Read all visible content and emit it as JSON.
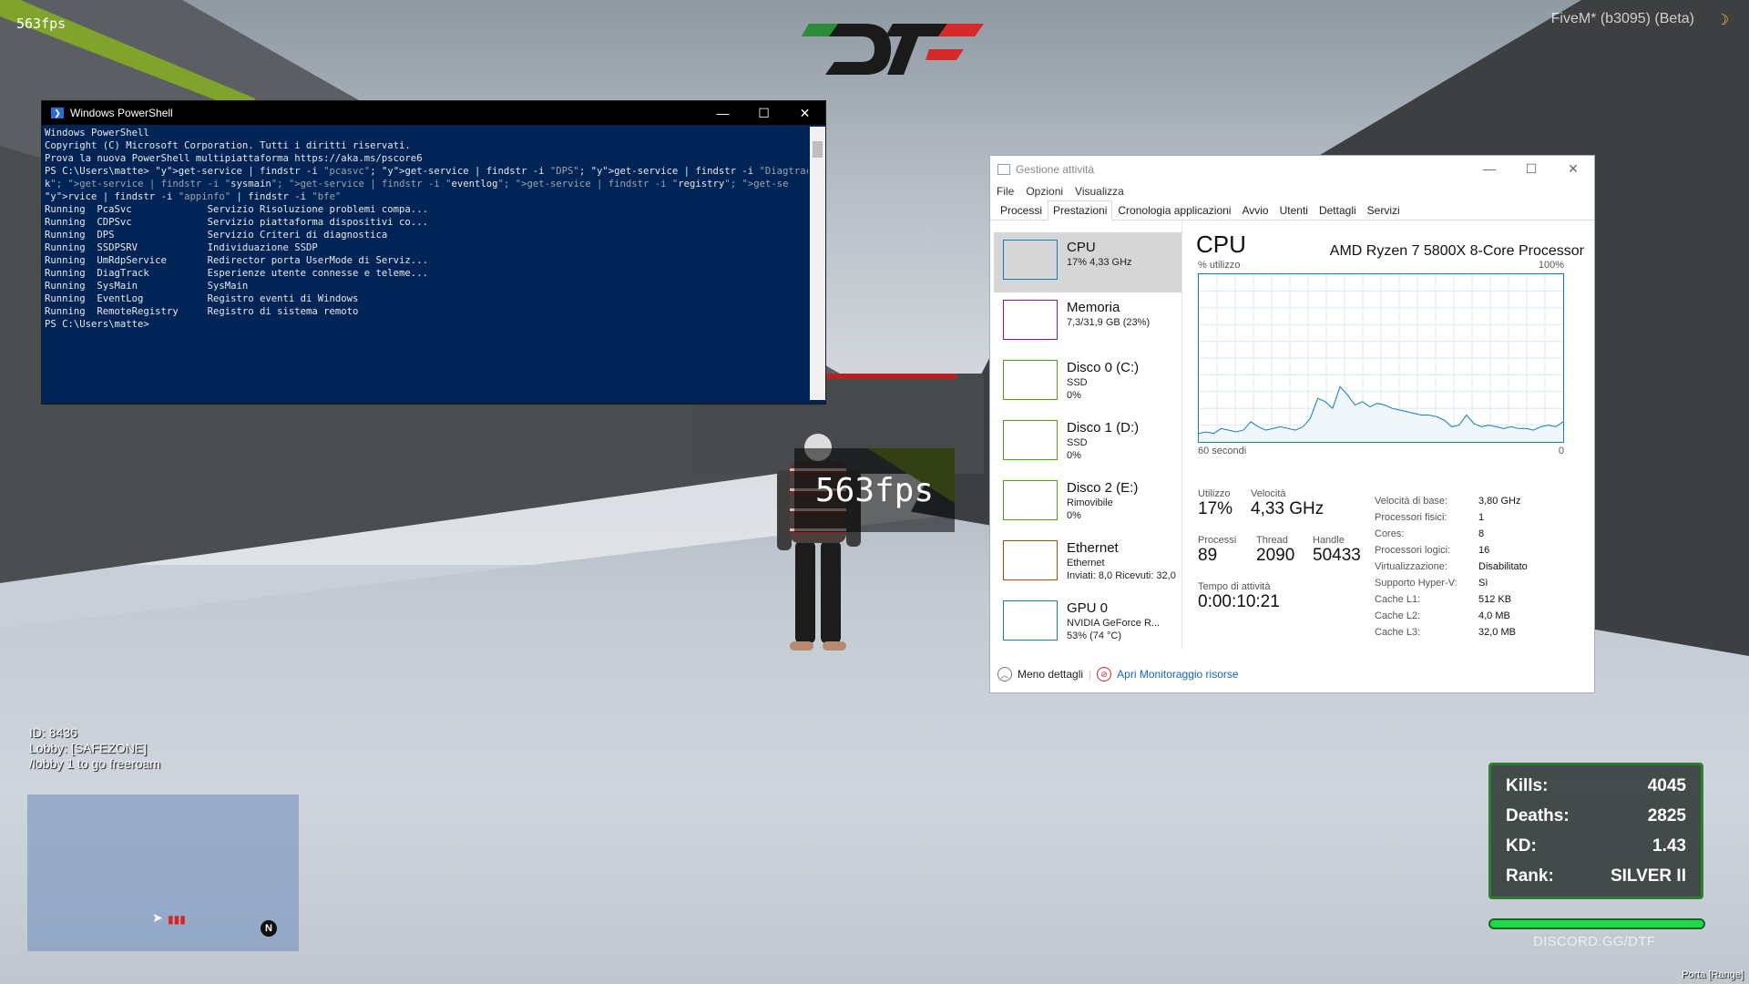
{
  "hud": {
    "fps_top": "563fps",
    "fps_overlay": "563fps",
    "fivem_label": "FiveM* (b3095) (Beta)",
    "lobby_lines": [
      "ID: 8436",
      "Lobby: [SAFEZONE]",
      "/lobby 1 to go freeroam"
    ],
    "stats": [
      {
        "label": "Kills:",
        "value": "4045"
      },
      {
        "label": "Deaths:",
        "value": "2825"
      },
      {
        "label": "KD:",
        "value": "1.43"
      },
      {
        "label": "Rank:",
        "value": "SILVER II"
      }
    ],
    "discord": "DISCORD.GG/DTF",
    "corner": "Porta [Range]",
    "minimap_north": "N",
    "health_fraction": 1.0
  },
  "powershell": {
    "title": "Windows PowerShell",
    "lines": [
      "Windows PowerShell",
      "Copyright (C) Microsoft Corporation. Tutti i diritti riservati.",
      "",
      "Prova la nuova PowerShell multipiattaforma https://aka.ms/pscore6",
      "",
      "PS C:\\Users\\matte> get-service | findstr -i \"pcasvc\"; get-service | findstr -i \"DPS\"; get-service | findstr -i \"Diagtrac",
      "k\"; get-service | findstr -i \"sysmain\"; get-service | findstr -i \"eventlog\"; get-service | findstr -i \"registry\"; get-se",
      "rvice | findstr -i \"appinfo\" | findstr -i \"bfe\"",
      "Running  PcaSvc             Servizio Risoluzione problemi compa...",
      "Running  CDPSvc             Servizio piattaforma dispositivi co...",
      "Running  DPS                Servizio Criteri di diagnostica",
      "Running  SSDPSRV            Individuazione SSDP",
      "Running  UmRdpService       Redirector porta UserMode di Serviz...",
      "Running  DiagTrack          Esperienze utente connesse e teleme...",
      "Running  SysMain            SysMain",
      "Running  EventLog           Registro eventi di Windows",
      "Running  RemoteRegistry     Registro di sistema remoto",
      "PS C:\\Users\\matte>"
    ]
  },
  "taskmgr": {
    "title": "Gestione attività",
    "menu": [
      "File",
      "Opzioni",
      "Visualizza"
    ],
    "tabs": [
      "Processi",
      "Prestazioni",
      "Cronologia applicazioni",
      "Avvio",
      "Utenti",
      "Dettagli",
      "Servizi"
    ],
    "active_tab": "Prestazioni",
    "resources": [
      {
        "name": "CPU",
        "l1": "17% 4,33 GHz",
        "l2": "",
        "l3": "",
        "color": "#117dbb"
      },
      {
        "name": "Memoria",
        "l1": "7,3/31,9 GB (23%)",
        "l2": "",
        "l3": "",
        "color": "#8b12ae"
      },
      {
        "name": "Disco 0 (C:)",
        "l1": "SSD",
        "l2": "0%",
        "l3": "",
        "color": "#4da60c"
      },
      {
        "name": "Disco 1 (D:)",
        "l1": "SSD",
        "l2": "0%",
        "l3": "",
        "color": "#4da60c"
      },
      {
        "name": "Disco 2 (E:)",
        "l1": "Rimovibile",
        "l2": "0%",
        "l3": "",
        "color": "#4da60c"
      },
      {
        "name": "Ethernet",
        "l1": "Ethernet",
        "l2": "Inviati: 8,0 Ricevuti: 32,0",
        "l3": "",
        "color": "#a74f01"
      },
      {
        "name": "GPU 0",
        "l1": "NVIDIA GeForce R...",
        "l2": "53% (74 °C)",
        "l3": "",
        "color": "#117dbb"
      }
    ],
    "cpu": {
      "heading": "CPU",
      "model": "AMD Ryzen 7 5800X 8-Core Processor",
      "usage_label": "% utilizzo",
      "max_label": "100%",
      "time_label": "60 secondi",
      "min_label": "0",
      "utilizzo_k": "Utilizzo",
      "utilizzo_v": "17%",
      "velocita_k": "Velocità",
      "velocita_v": "4,33 GHz",
      "processi_k": "Processi",
      "processi_v": "89",
      "thread_k": "Thread",
      "thread_v": "2090",
      "handle_k": "Handle",
      "handle_v": "50433",
      "uptime_k": "Tempo di attività",
      "uptime_v": "0:00:10:21",
      "props": [
        {
          "k": "Velocità di base:",
          "v": "3,80 GHz"
        },
        {
          "k": "Processori fisici:",
          "v": "1"
        },
        {
          "k": "Cores:",
          "v": "8"
        },
        {
          "k": "Processori logici:",
          "v": "16"
        },
        {
          "k": "Virtualizzazione:",
          "v": "Disabilitato"
        },
        {
          "k": "Supporto Hyper-V:",
          "v": "Sì"
        },
        {
          "k": "Cache L1:",
          "v": "512 KB"
        },
        {
          "k": "Cache L2:",
          "v": "4,0 MB"
        },
        {
          "k": "Cache L3:",
          "v": "32,0 MB"
        }
      ],
      "history": [
        5,
        6,
        5,
        8,
        7,
        6,
        7,
        12,
        9,
        7,
        8,
        9,
        8,
        7,
        9,
        14,
        26,
        24,
        20,
        33,
        28,
        22,
        24,
        21,
        23,
        22,
        20,
        19,
        18,
        17,
        16,
        16,
        15,
        13,
        9,
        10,
        16,
        11,
        9,
        10,
        9,
        8,
        9,
        8,
        8,
        7,
        9,
        10,
        9,
        12
      ]
    },
    "footer_less": "Meno dettagli",
    "footer_link": "Apri Monitoraggio risorse"
  },
  "colors": {
    "ps_bg": "#012456",
    "ps_yellow": "#f2e84b",
    "tm_accent": "#117dbb",
    "hud_green": "#2e7d32"
  }
}
